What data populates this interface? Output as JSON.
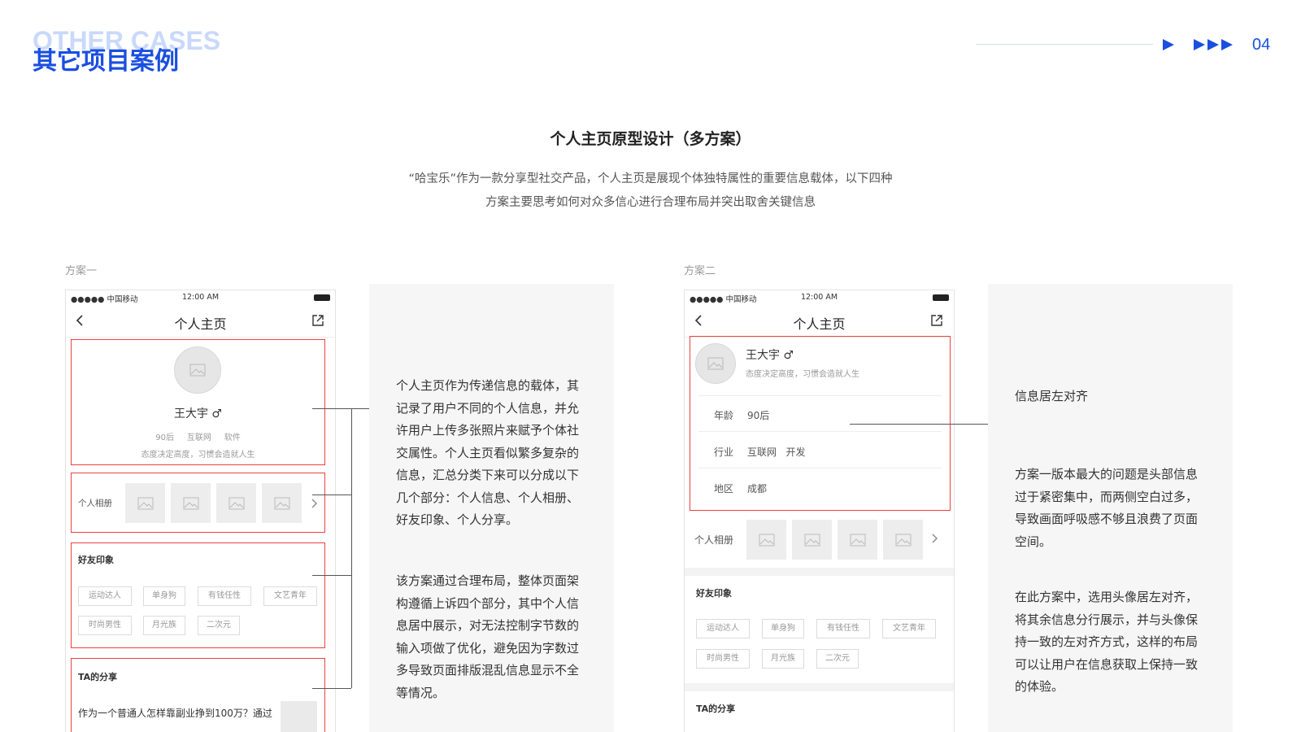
{
  "header": {
    "title_en": "OTHER CASES",
    "title_cn": "其它项目案例",
    "page_number": "04",
    "accent_color": "#1a4fe0"
  },
  "section": {
    "title": "个人主页原型设计（多方案）",
    "intro_line1": "“哈宝乐”作为一款分享型社交产品，个人主页是展现个体独特属性的重要信息载体，以下四种",
    "intro_line2": "方案主要思考如何对众多信心进行合理布局并突出取舍关键信息"
  },
  "plan1": {
    "label": "方案一",
    "status": {
      "carrier": "●●●●● 中国移动",
      "time": "12:00 AM"
    },
    "nav_title": "个人主页",
    "name": "王大宇 ♂",
    "info_line": "90后     互联网     软件",
    "motto": "态度决定高度，习惯会造就人生",
    "album_label": "个人相册",
    "impression_label": "好友印象",
    "tags_row1": [
      "运动达人",
      "单身狗",
      "有钱任性",
      "文艺青年"
    ],
    "tags_row2": [
      "时尚男性",
      "月光族",
      "二次元"
    ],
    "share_label": "TA的分享",
    "share_text": "作为一个普通人怎样靠副业挣到100万？通过",
    "desc_p1": [
      "个人主页作为传递信息的载体，其",
      "记录了用户不同的个人信息，并允",
      "许用户上传多张照片来赋予个体社",
      "交属性。个人主页看似繁多复杂的",
      "信息，汇总分类下来可以分成以下",
      "几个部分：个人信息、个人相册、",
      "好友印象、个人分享。"
    ],
    "desc_p2": [
      "该方案通过合理布局，整体页面架",
      "构遵循上诉四个部分，其中个人信",
      "息居中展示，对无法控制字节数的",
      "输入项做了优化，避免因为字数过",
      "多导致页面排版混乱信息显示不全",
      "等情况。"
    ]
  },
  "plan2": {
    "label": "方案二",
    "status": {
      "carrier": "●●●●● 中国移动",
      "time": "12:00 AM"
    },
    "nav_title": "个人主页",
    "name": "王大宇 ♂",
    "motto": "态度决定高度，习惯会造就人生",
    "rows": [
      {
        "key": "年龄",
        "value": "90后"
      },
      {
        "key": "行业",
        "value": "互联网   开发"
      },
      {
        "key": "地区",
        "value": "成都"
      }
    ],
    "album_label": "个人相册",
    "impression_label": "好友印象",
    "tags_row1": [
      "运动达人",
      "单身狗",
      "有钱任性",
      "文艺青年"
    ],
    "tags_row2": [
      "时尚男性",
      "月光族",
      "二次元"
    ],
    "share_label": "TA的分享",
    "callout": "信息居左对齐",
    "desc_p1": [
      "方案一版本最大的问题是头部信息",
      "过于紧密集中，而两侧空白过多，",
      "导致画面呼吸感不够且浪费了页面",
      "空间。"
    ],
    "desc_p2": [
      "在此方案中，选用头像居左对齐，",
      "将其余信息分行展示，并与头像保",
      "持一致的左对齐方式，这样的布局",
      "可以让用户在信息获取上保持一致",
      "的体验。"
    ]
  }
}
